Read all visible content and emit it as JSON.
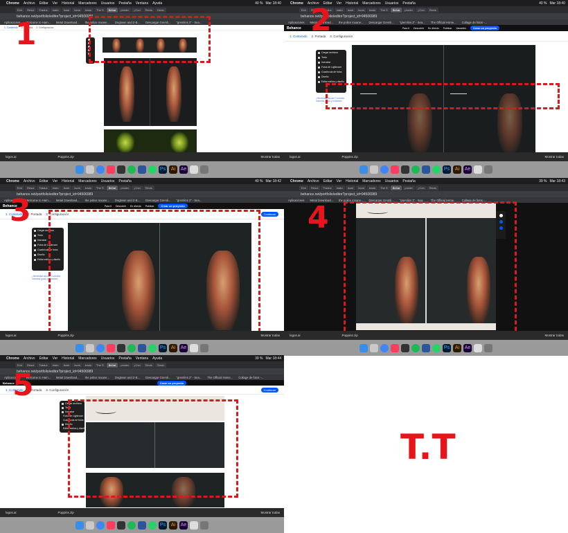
{
  "menubar": {
    "app": "Chrome",
    "items": [
      "Archivo",
      "Editar",
      "Ver",
      "Historial",
      "Marcadores",
      "Usuarios",
      "Pestaña",
      "Ventana",
      "Ayuda"
    ],
    "battery_p1": "40 %",
    "time_p1": "Mar 18:40",
    "battery_p2": "40 %",
    "time_p2": "Mar 18:40",
    "battery_p3": "40 %",
    "time_p3": "Mar 18:42",
    "battery_p4": "39 %",
    "time_p4": "Mar 18:43",
    "battery_p5": "39 %",
    "time_p5": "Mar 18:44"
  },
  "tabs": [
    "Extr",
    "Resul",
    "Traduc",
    "mato",
    "Isom",
    "Isom",
    "tradu",
    "The S",
    "Behar",
    "proder",
    "¿Con",
    "Revis",
    "Geolc"
  ],
  "address": "behance.net/portfolio/editor?project_id=94506989",
  "bookmarks": [
    "Aplicaciones",
    "Welcome to Ham...",
    "Metal Download...",
    "the police roxane...",
    "Dogtown and Z-B...",
    "Descargar Gremli...",
    "\"gremlins 2\" - Sea...",
    "The Official Home...",
    "Collage de fotos -..."
  ],
  "behance": {
    "logo": "Behance",
    "nav": [
      "Para ti",
      "Descubrir",
      "En directo",
      "Publicar",
      "Vacantes"
    ],
    "cta": "Crear un proyecto"
  },
  "steps": {
    "s1": "1. Contenido",
    "s2": "2. Portada",
    "s3": "3. Configuración",
    "continue": "Continuar"
  },
  "sidemenu": [
    "Cargar archivos",
    "Texto",
    "Incrustar",
    "Fotos de Lightroom",
    "Cuadrícula de fotos",
    "Diseño",
    "Editar estilos y diseño"
  ],
  "adobe_link": "¿Necesitas ayuda? Consulta nuestras guías y tutoriales",
  "taskbar": {
    "file1": "logos.ai",
    "file2": "Poppins.zip",
    "show_all": "Mostrar todas"
  },
  "dock_apps": {
    "ps": "Ps",
    "ai": "Ai",
    "ae": "Ae"
  },
  "labels": {
    "n1": "1",
    "n2": "2",
    "n3": "3",
    "n4": "4",
    "n5": "5",
    "tt": "T.T"
  }
}
